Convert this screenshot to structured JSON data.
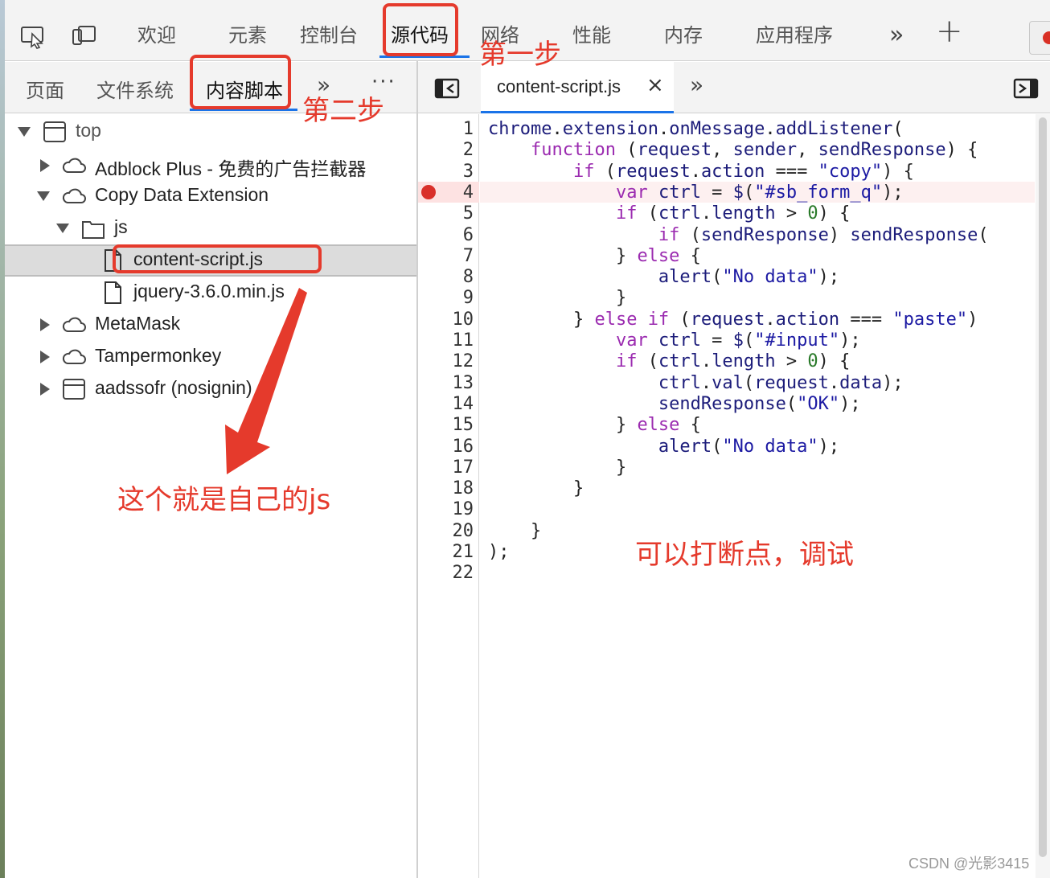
{
  "toolbar": {
    "tabs": [
      {
        "label": "欢迎"
      },
      {
        "label": "元素"
      },
      {
        "label": "控制台"
      },
      {
        "label": "源代码"
      },
      {
        "label": "网络"
      },
      {
        "label": "性能"
      },
      {
        "label": "内存"
      },
      {
        "label": "应用程序"
      }
    ],
    "active_tab": "源代码",
    "more_symbol": "»",
    "add_symbol": "+"
  },
  "sources_sidebar": {
    "tabs": [
      {
        "label": "页面"
      },
      {
        "label": "文件系统"
      },
      {
        "label": "内容脚本"
      }
    ],
    "active_tab": "内容脚本",
    "more_symbol": "»",
    "menu_symbol": "⋮"
  },
  "file_tree": [
    {
      "label": "top",
      "type": "frame",
      "expanded": true
    },
    {
      "label": "Adblock Plus - 免费的广告拦截器",
      "type": "extension",
      "expanded": false
    },
    {
      "label": "Copy Data Extension",
      "type": "extension",
      "expanded": true
    },
    {
      "label": "js",
      "type": "folder",
      "expanded": true
    },
    {
      "label": "content-script.js",
      "type": "file",
      "selected": true
    },
    {
      "label": "jquery-3.6.0.min.js",
      "type": "file"
    },
    {
      "label": "MetaMask",
      "type": "extension",
      "expanded": false
    },
    {
      "label": "Tampermonkey",
      "type": "extension",
      "expanded": false
    },
    {
      "label": "aadssofr (nosignin)",
      "type": "frame",
      "expanded": false
    }
  ],
  "editor": {
    "open_file": "content-script.js",
    "close_symbol": "×",
    "more_symbol": "»",
    "breakpoint_line": 4,
    "line_numbers": [
      "1",
      "2",
      "3",
      "4",
      "5",
      "6",
      "7",
      "8",
      "9",
      "10",
      "11",
      "12",
      "13",
      "14",
      "15",
      "16",
      "17",
      "18",
      "19",
      "20",
      "21",
      "22"
    ],
    "code_lines": [
      "chrome.extension.onMessage.addListener(",
      "    function (request, sender, sendResponse) {",
      "        if (request.action === \"copy\") {",
      "            var ctrl = $(\"#sb_form_q\");",
      "            if (ctrl.length > 0) {",
      "                if (sendResponse) sendResponse(",
      "            } else {",
      "                alert(\"No data\");",
      "            }",
      "        } else if (request.action === \"paste\")",
      "            var ctrl = $(\"#input\");",
      "            if (ctrl.length > 0) {",
      "                ctrl.val(request.data);",
      "                sendResponse(\"OK\");",
      "            } else {",
      "                alert(\"No data\");",
      "            }",
      "        }",
      "",
      "    }",
      ");",
      ""
    ]
  },
  "annotations": {
    "step1": "第一步",
    "step2": "第二步",
    "this_is_js": "这个就是自己的js",
    "breakpoint_hint": "可以打断点，调试"
  },
  "watermark": "CSDN @光影3415",
  "colors": {
    "annotation": "#e53a2c",
    "active_underline": "#1a73e8",
    "breakpoint": "#d9302a",
    "keyword": "#9b2bb0",
    "string": "#1c1aa3"
  }
}
